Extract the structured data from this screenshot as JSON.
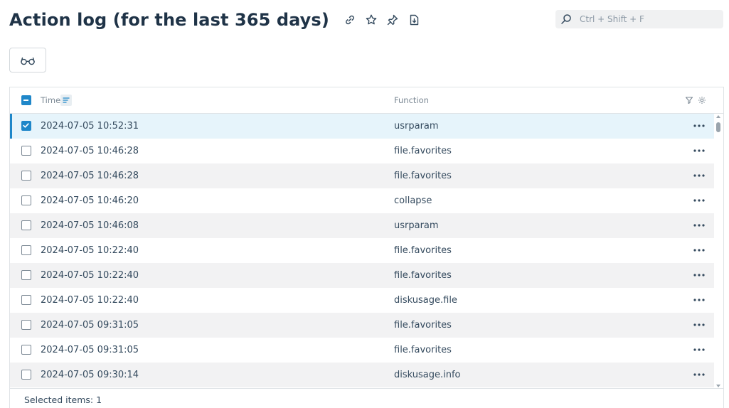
{
  "header": {
    "title": "Action log (for the last 365 days)",
    "icons": [
      "link-icon",
      "star-icon",
      "pin-icon",
      "export-icon"
    ]
  },
  "search": {
    "placeholder": "Ctrl + Shift + F",
    "value": ""
  },
  "toolbar": {
    "view_icon": "glasses-icon"
  },
  "table": {
    "columns": {
      "time": "Time",
      "function": "Function"
    },
    "rows": [
      {
        "time": "2024-07-05 10:52:31",
        "function": "usrparam",
        "checked": true
      },
      {
        "time": "2024-07-05 10:46:28",
        "function": "file.favorites",
        "checked": false
      },
      {
        "time": "2024-07-05 10:46:28",
        "function": "file.favorites",
        "checked": false
      },
      {
        "time": "2024-07-05 10:46:20",
        "function": "collapse",
        "checked": false
      },
      {
        "time": "2024-07-05 10:46:08",
        "function": "usrparam",
        "checked": false
      },
      {
        "time": "2024-07-05 10:22:40",
        "function": "file.favorites",
        "checked": false
      },
      {
        "time": "2024-07-05 10:22:40",
        "function": "file.favorites",
        "checked": false
      },
      {
        "time": "2024-07-05 10:22:40",
        "function": "diskusage.file",
        "checked": false
      },
      {
        "time": "2024-07-05 09:31:05",
        "function": "file.favorites",
        "checked": false
      },
      {
        "time": "2024-07-05 09:31:05",
        "function": "file.favorites",
        "checked": false
      },
      {
        "time": "2024-07-05 09:30:14",
        "function": "diskusage.info",
        "checked": false
      }
    ]
  },
  "footer": {
    "selected_label": "Selected items: 1"
  },
  "colors": {
    "accent": "#1f87c9",
    "selected_row": "#e6f4fb",
    "alt_row": "#f2f2f3"
  }
}
